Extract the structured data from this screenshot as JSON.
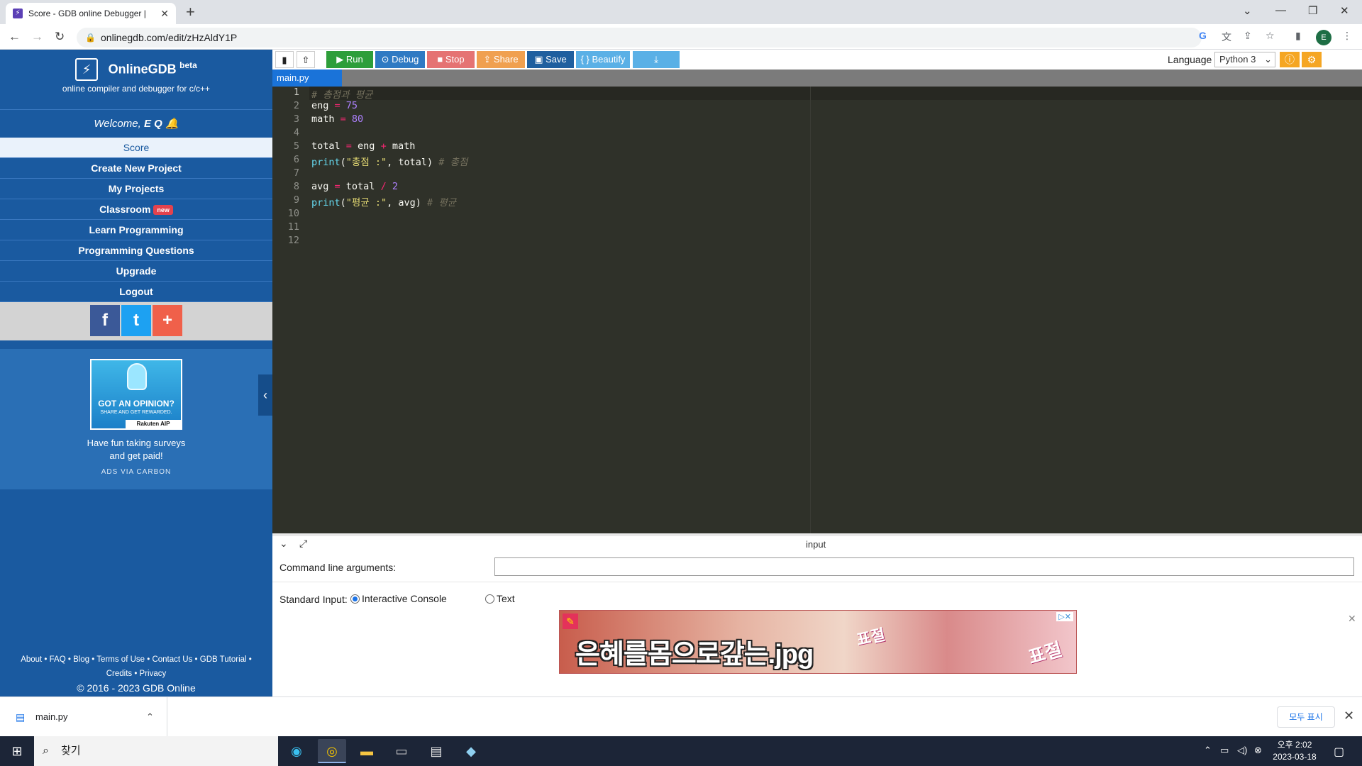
{
  "browser": {
    "tab_title": "Score - GDB online Debugger |",
    "url": "onlinegdb.com/edit/zHzAldY1P",
    "profile_initial": "E"
  },
  "sidebar": {
    "brand_name": "OnlineGDB",
    "brand_beta": "beta",
    "brand_subtitle": "online compiler and debugger for c/c++",
    "welcome_prefix": "Welcome, ",
    "welcome_user": "E Q",
    "items": [
      {
        "label": "Score",
        "active": true
      },
      {
        "label": "Create New Project"
      },
      {
        "label": "My Projects"
      },
      {
        "label": "Classroom",
        "badge": "new"
      },
      {
        "label": "Learn Programming"
      },
      {
        "label": "Programming Questions"
      },
      {
        "label": "Upgrade"
      },
      {
        "label": "Logout"
      }
    ],
    "ad": {
      "headline": "GOT AN OPINION?",
      "subline": "SHARE AND GET REWARDED.",
      "brand": "Rakuten AIP",
      "text_line1": "Have fun taking surveys",
      "text_line2": "and get paid!",
      "carbon": "ADS VIA CARBON"
    },
    "footer_links": "About • FAQ • Blog • Terms of Use • Contact Us • GDB Tutorial •",
    "footer_links2": "Credits • Privacy",
    "copyright": "© 2016 - 2023 GDB Online"
  },
  "toolbar": {
    "run": "Run",
    "debug": "Debug",
    "stop": "Stop",
    "share": "Share",
    "save": "Save",
    "beautify": "{ } Beautify",
    "language_label": "Language",
    "language_value": "Python 3"
  },
  "editor": {
    "filename": "main.py",
    "line_numbers": [
      "1",
      "2",
      "3",
      "4",
      "5",
      "6",
      "7",
      "8",
      "9",
      "10",
      "11",
      "12"
    ],
    "code": {
      "l1_comment": "# 총점과 평균",
      "l2_var": "eng ",
      "l2_op": "=",
      "l2_num": " 75",
      "l3_var": "math ",
      "l3_op": "=",
      "l3_num": " 80",
      "l5_a": "total ",
      "l5_op1": "=",
      "l5_b": " eng ",
      "l5_op2": "+",
      "l5_c": " math",
      "l6_fn": "print",
      "l6_p1": "(",
      "l6_str": "\"총점 :\"",
      "l6_rest": ", total) ",
      "l6_cm": "# 총점",
      "l8_a": "avg ",
      "l8_op1": "=",
      "l8_b": " total ",
      "l8_op2": "/",
      "l8_num": " 2",
      "l9_fn": "print",
      "l9_p1": "(",
      "l9_str": "\"평균 :\"",
      "l9_rest": ", avg) ",
      "l9_cm": "# 평균"
    }
  },
  "input_panel": {
    "title": "input",
    "cmd_label": "Command line arguments:",
    "cmd_value": "",
    "stdin_label": "Standard Input:",
    "opt_interactive": "Interactive Console",
    "opt_text": "Text",
    "stdin_selected": "Interactive Console",
    "banner_text": "은혜를몸으로갚는.jpg",
    "banner_sticker": "표절"
  },
  "downloads": {
    "file": "main.py",
    "show_all": "모두 표시"
  },
  "taskbar": {
    "search_placeholder": "찾기",
    "time": "오후 2:02",
    "date": "2023-03-18"
  }
}
